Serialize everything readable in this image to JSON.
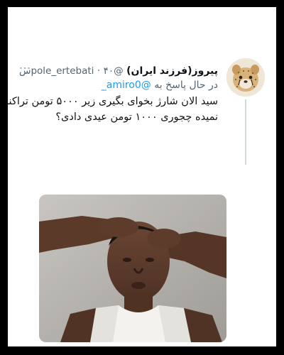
{
  "tweet": {
    "display_name": "پیروز(فرزند ایران)",
    "handle": "@pole_ertebati",
    "dot": "·",
    "time": "۴۰س",
    "replying_prefix": "در حال پاسخ به",
    "replying_to": "@amiro0_",
    "text_lines": [
      "سید الان شارژ بخوای بگیری زیر ۵۰۰۰ تومن تراکنش",
      "نمیده چجوری ۱۰۰۰ تومن عیدی دادی؟"
    ],
    "more_icon": "more-vertical-icon",
    "avatar_icon": "cheetah-avatar",
    "media_icon": "reaction-photo"
  },
  "colors": {
    "background": "#ffffff",
    "outer": "#000000",
    "text": "#0f1419",
    "secondary": "#536471",
    "link": "#1d9bf0",
    "thread_line": "#cfd9de"
  }
}
